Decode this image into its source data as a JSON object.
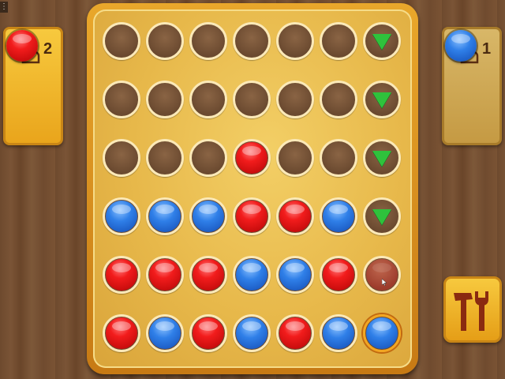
{
  "players": [
    {
      "id": "p2",
      "number": "2",
      "color": "red",
      "active": true
    },
    {
      "id": "p1",
      "number": "1",
      "color": "blue",
      "active": false
    }
  ],
  "board": {
    "rows": [
      [
        "empty",
        "empty",
        "empty",
        "empty",
        "empty",
        "empty",
        "arrow"
      ],
      [
        "empty",
        "empty",
        "empty",
        "empty",
        "empty",
        "empty",
        "arrow"
      ],
      [
        "empty",
        "empty",
        "empty",
        "red",
        "empty",
        "empty",
        "arrow"
      ],
      [
        "blue",
        "blue",
        "blue",
        "red",
        "red",
        "blue",
        "arrow"
      ],
      [
        "red",
        "red",
        "red",
        "blue",
        "blue",
        "red",
        "ghost"
      ],
      [
        "red",
        "blue",
        "red",
        "blue",
        "red",
        "blue",
        "blue-highlight"
      ]
    ]
  },
  "colors": {
    "red": "#e81414",
    "blue": "#2a75e0",
    "arrow": "#2fc23c",
    "panel": "#f2b630"
  },
  "icons": {
    "player": "person-icon",
    "tools": "hammer-wrench-icon",
    "menu": "menu-dots-icon"
  }
}
